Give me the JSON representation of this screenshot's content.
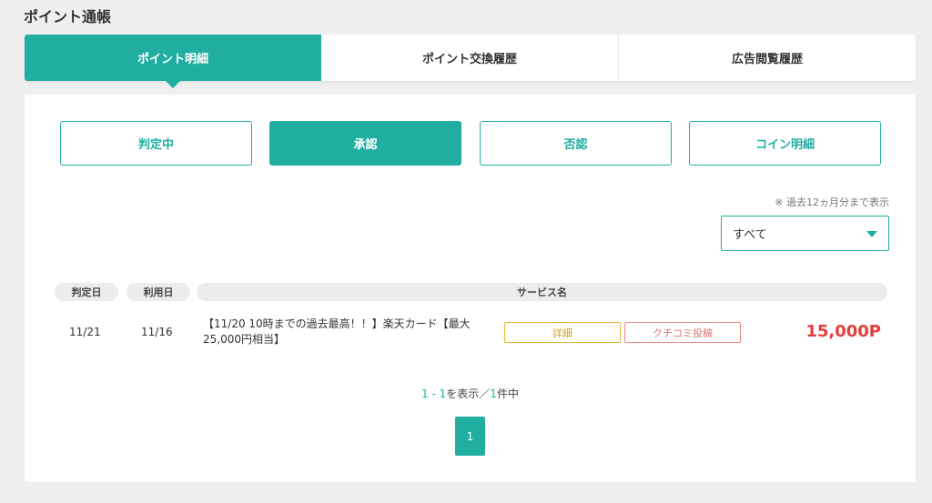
{
  "page": {
    "title": "ポイント通帳"
  },
  "top_tabs": [
    {
      "label": "ポイント明細",
      "active": true
    },
    {
      "label": "ポイント交換履歴",
      "active": false
    },
    {
      "label": "広告閲覧履歴",
      "active": false
    }
  ],
  "filters": [
    {
      "label": "判定中",
      "active": false
    },
    {
      "label": "承認",
      "active": true
    },
    {
      "label": "否認",
      "active": false
    },
    {
      "label": "コイン明細",
      "active": false
    }
  ],
  "note": "※ 過去12ヵ月分まで表示",
  "select": {
    "value": "すべて",
    "icon": "caret-down-icon"
  },
  "table": {
    "headers": {
      "judged_date": "判定日",
      "used_date": "利用日",
      "service": "サービス名"
    },
    "rows": [
      {
        "judged_date": "11/21",
        "used_date": "11/16",
        "service": "【11/20 10時までの過去最高！！】楽天カード【最大25,000円相当】",
        "detail_label": "詳細",
        "review_label": "クチコミ投稿",
        "points": "15,000P"
      }
    ]
  },
  "pagination": {
    "range": "1 - 1",
    "range_suffix": "を表示／",
    "total": "1",
    "total_suffix": "件中",
    "current_page": "1"
  },
  "colors": {
    "accent": "#20aea0",
    "points": "#e83c3c",
    "detail_border": "#e7b530",
    "review_border": "#e98a8a",
    "background": "#efefef"
  }
}
